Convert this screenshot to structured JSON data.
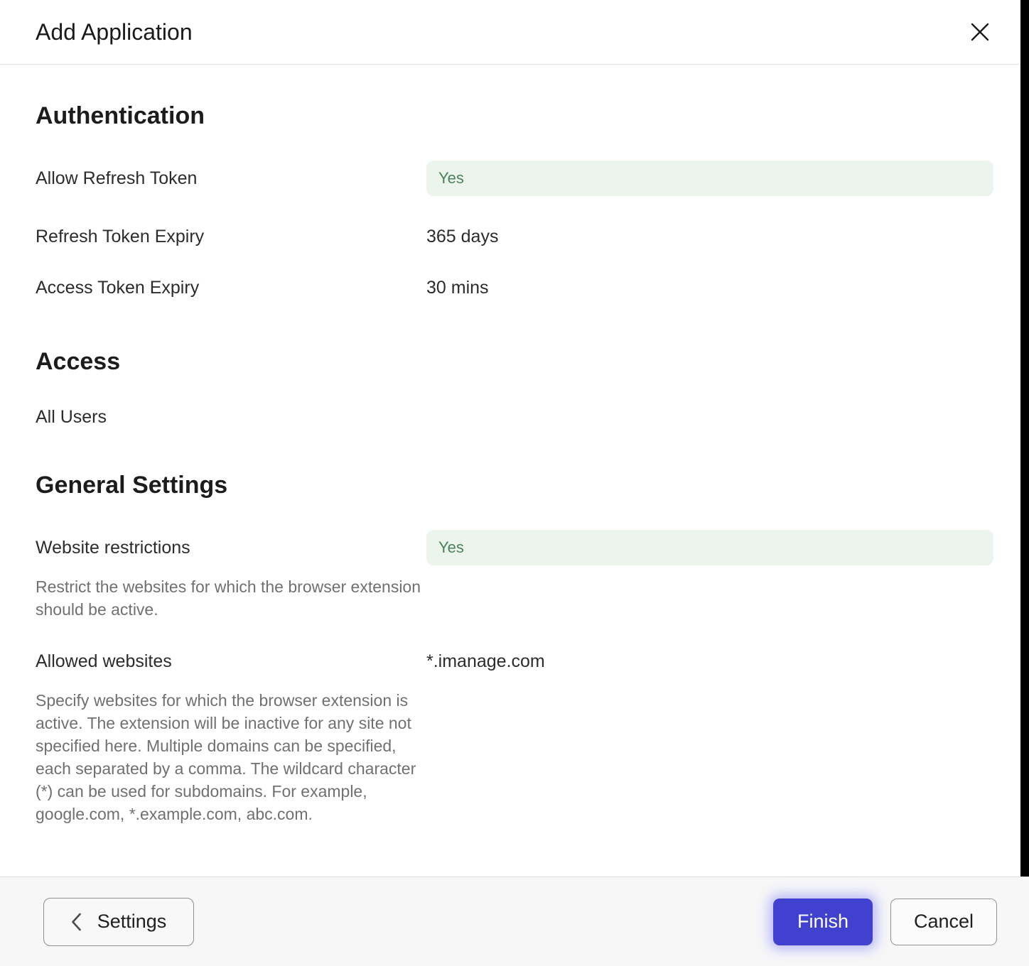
{
  "header": {
    "title": "Add Application"
  },
  "sections": {
    "authentication": {
      "heading": "Authentication",
      "rows": [
        {
          "label": "Allow Refresh Token",
          "value": "Yes"
        },
        {
          "label": "Refresh Token Expiry",
          "value": "365 days"
        },
        {
          "label": "Access Token Expiry",
          "value": "30 mins"
        }
      ]
    },
    "access": {
      "heading": "Access",
      "items": [
        "All Users"
      ]
    },
    "general_settings": {
      "heading": "General Settings",
      "rows": [
        {
          "label": "Website restrictions",
          "value": "Yes",
          "description": "Restrict the websites for which the browser extension should be active."
        },
        {
          "label": "Allowed websites",
          "value": "*.imanage.com",
          "description": "Specify websites for which the browser extension is active. The extension will be inactive for any site not specified here. Multiple domains can be specified, each separated by a comma. The wildcard character (*) can be used for subdomains. For example, google.com, *.example.com, abc.com."
        }
      ]
    }
  },
  "footer": {
    "back_label": "Settings",
    "finish_label": "Finish",
    "cancel_label": "Cancel"
  },
  "colors": {
    "badge_bg": "#ebf5ed",
    "badge_text": "#4e8158",
    "primary_button": "#4141d0"
  }
}
